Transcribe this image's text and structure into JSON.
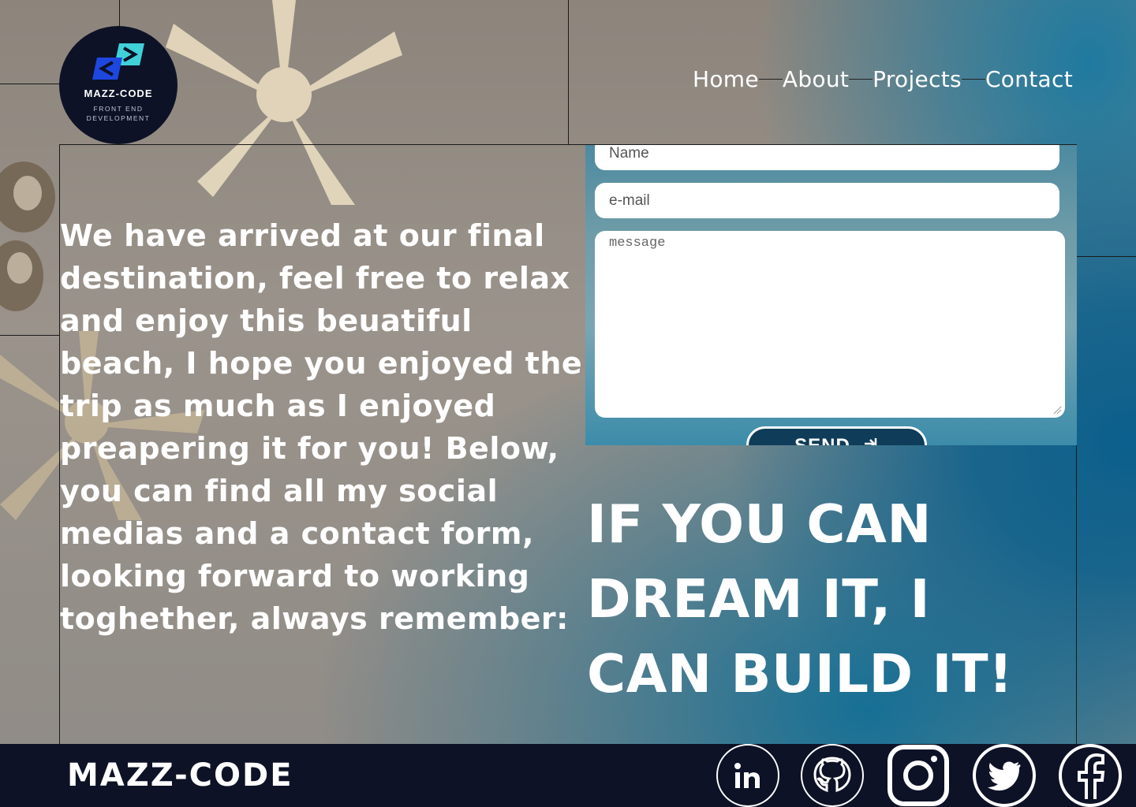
{
  "header": {
    "logo": {
      "name": "MAZZ-CODE",
      "tagline_line1": "FRONT END",
      "tagline_line2": "DEVELOPMENT"
    },
    "nav": {
      "home": "Home",
      "about": "About",
      "projects": "Projects",
      "contact": "Contact"
    }
  },
  "main": {
    "intro": " We have arrived at our final destination, feel free to relax and enjoy this beuatiful beach, I hope you enjoyed the trip as much as I enjoyed preapering it for you! Below, you can find all my social medias and a contact form, looking forward to working toghether, always  remember:",
    "form": {
      "name_placeholder": "Name",
      "email_placeholder": "e-mail",
      "message_placeholder": "message",
      "send_label": "SEND"
    },
    "quote": "IF YOU CAN DREAM IT, I CAN BUILD IT!"
  },
  "footer": {
    "brand": "MAZZ-CODE",
    "social_icons": [
      "linkedin-icon",
      "github-icon",
      "instagram-icon",
      "twitter-icon",
      "facebook-icon"
    ]
  },
  "colors": {
    "navy": "#0d1226",
    "ocean": "#0b5f8c",
    "white": "#ffffff",
    "button": "#0f3c58"
  }
}
